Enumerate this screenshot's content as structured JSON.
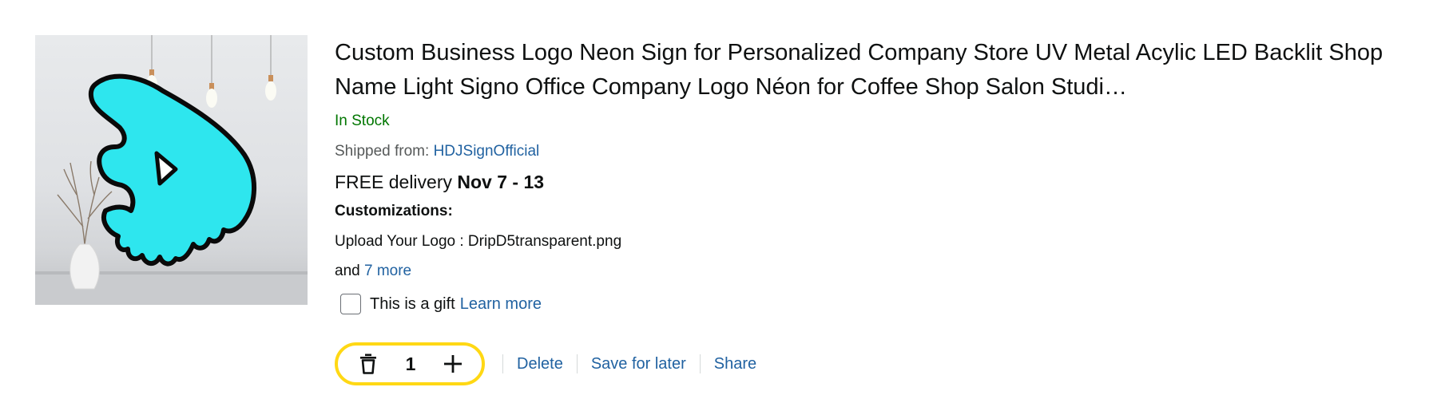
{
  "item": {
    "image_alt": "Cyan neon D logo sign",
    "title": "Custom Business Logo Neon Sign for Personalized Company Store UV Metal Acylic LED Backlit Shop Name Light Signo Office Company Logo Néon for Coffee Shop Salon Studi…",
    "stock": "In Stock",
    "shipped_label": "Shipped from: ",
    "seller": "HDJSignOfficial",
    "delivery_prefix": "FREE delivery ",
    "delivery_dates": "Nov 7 - 13",
    "customizations_heading": "Customizations:",
    "customization_line": "Upload Your Logo : DripD5transparent.png",
    "more_prefix": "and ",
    "more_link": "7 more",
    "gift_label": "This is a gift",
    "gift_learn_more": "Learn more",
    "gift_checked": false
  },
  "quantity": {
    "value": "1",
    "decrement_icon": "trash-icon",
    "increment_icon": "plus-icon"
  },
  "actions": {
    "delete": "Delete",
    "save_for_later": "Save for later",
    "share": "Share"
  },
  "colors": {
    "stock_green": "#007600",
    "link_blue": "#2162a1",
    "stepper_border": "#ffd814",
    "neon_cyan": "#2ee6ee"
  }
}
